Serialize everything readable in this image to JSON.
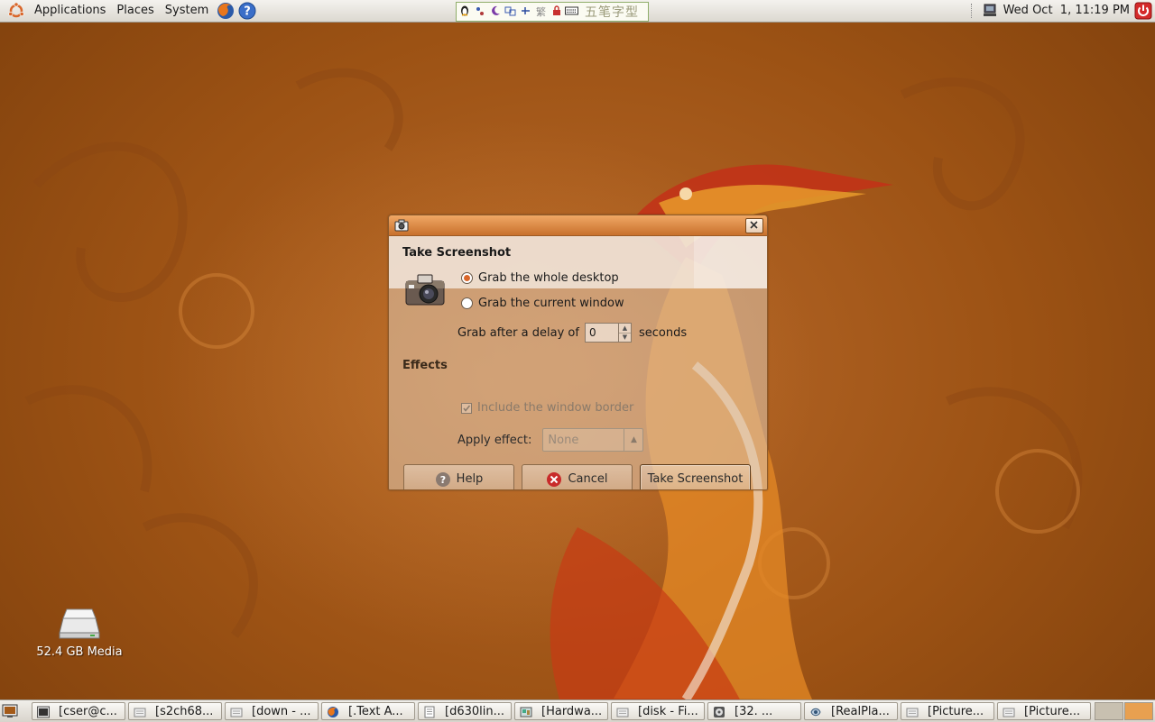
{
  "top_panel": {
    "menus": [
      "Applications",
      "Places",
      "System"
    ],
    "ime_label": "五笔字型",
    "ime_buttons": [
      "繁"
    ],
    "clock": "Wed Oct  1, 11:19 PM"
  },
  "desktop": {
    "icons": [
      {
        "label": "52.4 GB Media",
        "icon": "drive-icon"
      }
    ]
  },
  "dialog": {
    "title_icon": "camera-icon",
    "section_take": "Take Screenshot",
    "options": {
      "whole_desktop": "Grab the whole desktop",
      "current_window": "Grab the current window",
      "selected": "whole_desktop"
    },
    "delay": {
      "prefix": "Grab after a delay of",
      "value": "0",
      "suffix": "seconds"
    },
    "section_effects": "Effects",
    "include_border": "Include the window border",
    "apply_effect_label": "Apply effect:",
    "apply_effect_value": "None",
    "buttons": {
      "help": "Help",
      "cancel": "Cancel",
      "take": "Take Screenshot"
    }
  },
  "taskbar": {
    "tasks": [
      {
        "label": "[cser@c...",
        "icon": "terminal-icon"
      },
      {
        "label": "[s2ch68...",
        "icon": "document-icon"
      },
      {
        "label": "[down - ...",
        "icon": "document-icon"
      },
      {
        "label": "[.Text A...",
        "icon": "firefox-icon"
      },
      {
        "label": "[d630lin...",
        "icon": "text-file-icon"
      },
      {
        "label": "[Hardwa...",
        "icon": "hardware-icon"
      },
      {
        "label": "[disk - Fi...",
        "icon": "document-icon"
      },
      {
        "label": "[32. ...",
        "icon": "disc-icon"
      },
      {
        "label": "[RealPla...",
        "icon": "realplayer-icon"
      },
      {
        "label": "[Picture...",
        "icon": "document-icon"
      },
      {
        "label": "[Picture...",
        "icon": "document-icon"
      }
    ]
  },
  "colors": {
    "accent": "#d9662a",
    "titlebar": "#e08840",
    "desktop": "#a85a18"
  }
}
